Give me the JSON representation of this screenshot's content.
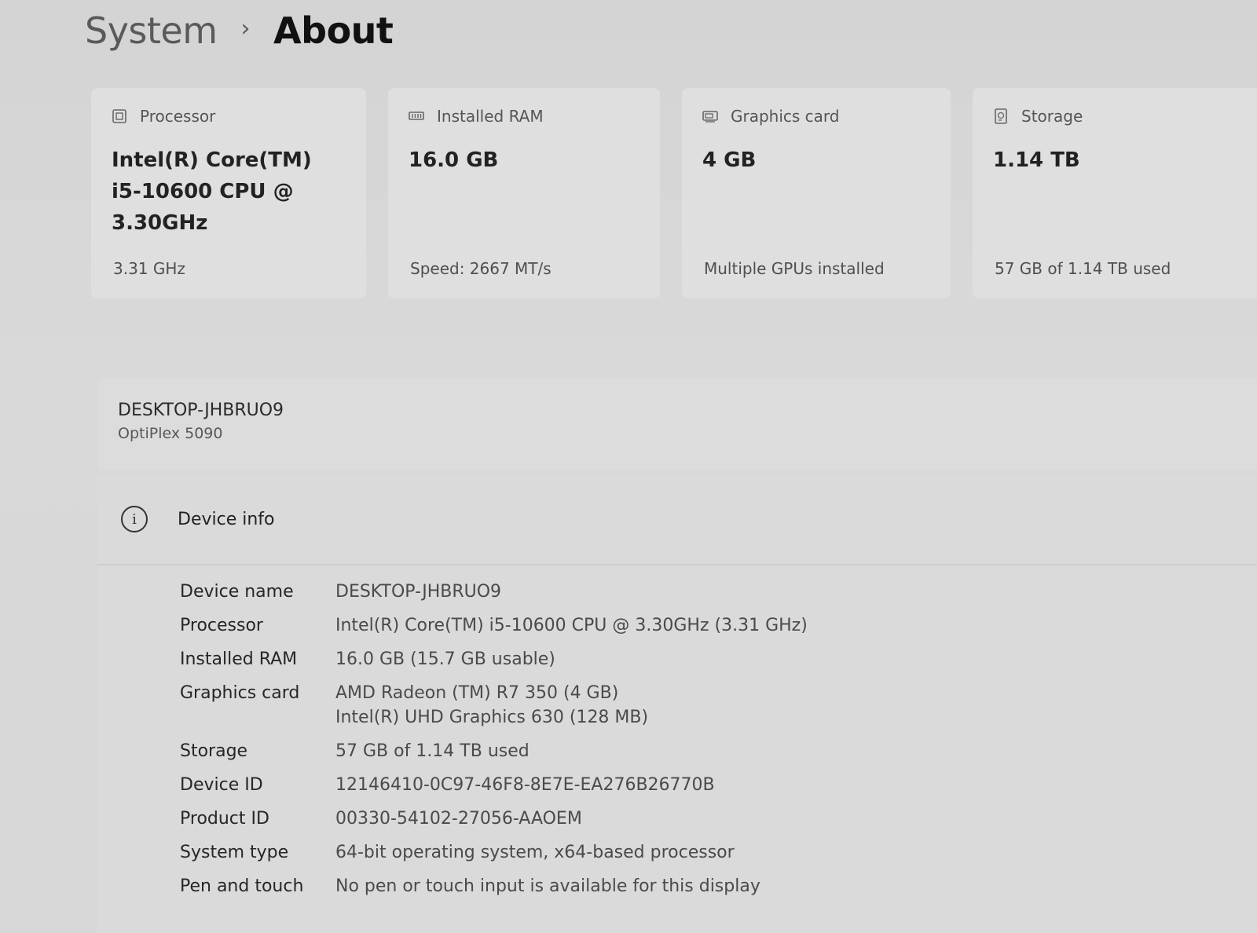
{
  "breadcrumb": {
    "parent": "System",
    "separator": "›",
    "current": "About"
  },
  "cards": {
    "processor": {
      "icon": "processor-icon",
      "label": "Processor",
      "value_line1": "Intel(R) Core(TM)",
      "value_line2": "i5-10600 CPU @",
      "value_line3": "3.30GHz",
      "sub": "3.31 GHz"
    },
    "ram": {
      "icon": "ram-icon",
      "label": "Installed RAM",
      "value": "16.0 GB",
      "sub": "Speed: 2667 MT/s"
    },
    "gpu": {
      "icon": "graphics-card-icon",
      "label": "Graphics card",
      "value": "4 GB",
      "sub": "Multiple GPUs installed"
    },
    "storage": {
      "icon": "storage-icon",
      "label": "Storage",
      "value": "1.14 TB",
      "sub": "57 GB of 1.14 TB used"
    }
  },
  "device": {
    "hostname": "DESKTOP-JHBRUO9",
    "model": "OptiPlex 5090"
  },
  "device_info": {
    "title": "Device info",
    "icon": "info-icon",
    "specs": [
      {
        "label": "Device name",
        "value": "DESKTOP-JHBRUO9"
      },
      {
        "label": "Processor",
        "value": "Intel(R) Core(TM) i5-10600 CPU @ 3.30GHz (3.31 GHz)"
      },
      {
        "label": "Installed RAM",
        "value": "16.0 GB (15.7 GB usable)"
      },
      {
        "label": "Graphics card",
        "value": "AMD Radeon (TM) R7 350 (4 GB)",
        "value2": "Intel(R) UHD Graphics 630 (128 MB)"
      },
      {
        "label": "Storage",
        "value": "57 GB of 1.14 TB used"
      },
      {
        "label": "Device ID",
        "value": "12146410-0C97-46F8-8E7E-EA276B26770B"
      },
      {
        "label": "Product ID",
        "value": "00330-54102-27056-AAOEM"
      },
      {
        "label": "System type",
        "value": "64-bit operating system, x64-based processor"
      },
      {
        "label": "Pen and touch",
        "value": "No pen or touch input is available for this display"
      }
    ]
  }
}
